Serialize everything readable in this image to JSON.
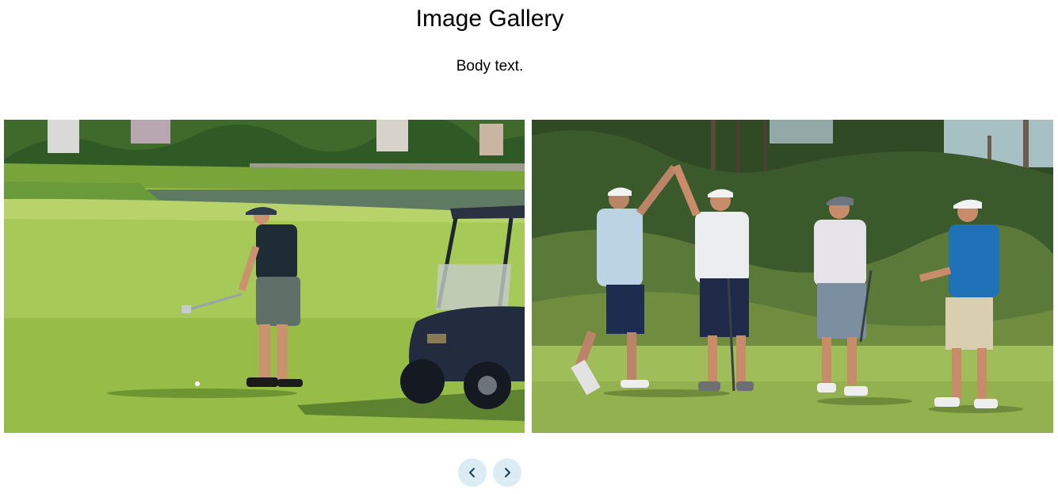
{
  "page": {
    "title": "Image Gallery",
    "body_text": "Body text."
  },
  "gallery": {
    "slides": [
      {
        "icon": "golf-photo-golfer-cart-icon"
      },
      {
        "icon": "golf-photo-high-five-icon"
      }
    ],
    "controls": {
      "prev_icon": "chevron-left-icon",
      "next_icon": "chevron-right-icon",
      "button_color": "#dcecf5",
      "arrow_color": "#1c3d5a"
    }
  }
}
